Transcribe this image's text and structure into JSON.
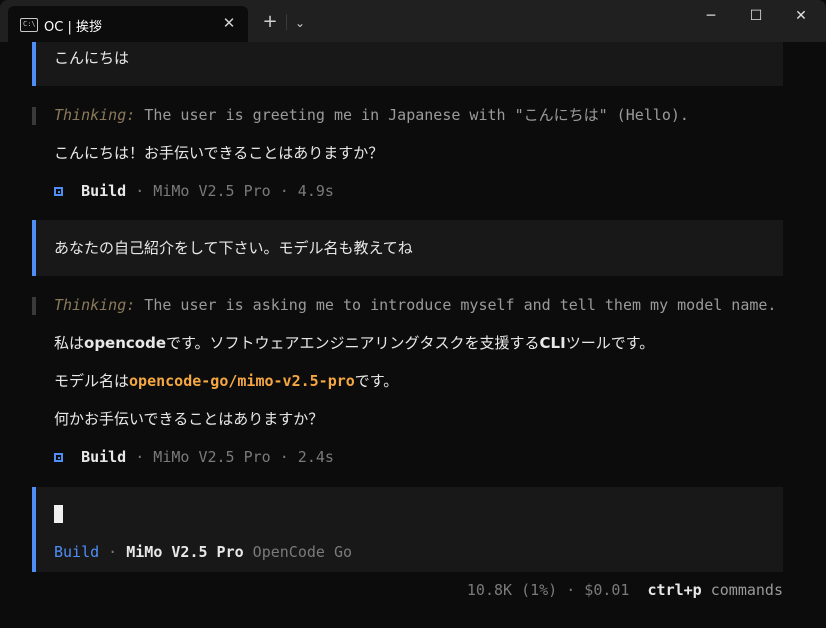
{
  "window": {
    "tab_title": "OC | 挨拶",
    "tab_icon_text": "C:\\",
    "close_tab_glyph": "✕",
    "new_tab_glyph": "+",
    "dropdown_glyph": "⌄",
    "minimize_glyph": "─",
    "maximize_glyph": "☐",
    "close_glyph": "✕"
  },
  "messages": {
    "user1": "こんにちは",
    "thinking1_label": "Thinking:",
    "thinking1_text": " The user is greeting me in Japanese with \"こんにちは\" (Hello).",
    "reply1": "こんにちは！お手伝いできることはありますか？",
    "meta1_agent": "Build",
    "meta1_rest": " · MiMo V2.5 Pro · 4.9s",
    "user2": "あなたの自己紹介をして下さい。モデル名も教えてね",
    "thinking2_label": "Thinking:",
    "thinking2_text": " The user is asking me to introduce myself and tell them my model name.",
    "reply2_pre": "私は",
    "reply2_bold1": "opencode",
    "reply2_mid": "です。ソフトウェアエンジニアリングタスクを支援する",
    "reply2_bold2": "CLI",
    "reply2_post": "ツールです。",
    "reply3_pre": "モデル名は",
    "reply3_model": "opencode-go/mimo-v2.5-pro",
    "reply3_post": "です。",
    "reply4": "何かお手伝いできることはありますか？",
    "meta2_agent": "Build",
    "meta2_rest": " · MiMo V2.5 Pro · 2.4s"
  },
  "input": {
    "agent": "Build",
    "dot": " · ",
    "model": "MiMo V2.5 Pro",
    "provider": " OpenCode Go"
  },
  "status": {
    "tokens": "10.8K (1%) · $0.01",
    "shortcut": "ctrl+p",
    "shortcut_label": " commands"
  },
  "colors": {
    "accent": "#4f8ef7",
    "thinking_label": "#8a7a5a",
    "model_highlight": "#f5a742",
    "text": "#e8e8e8",
    "muted": "#808080"
  }
}
